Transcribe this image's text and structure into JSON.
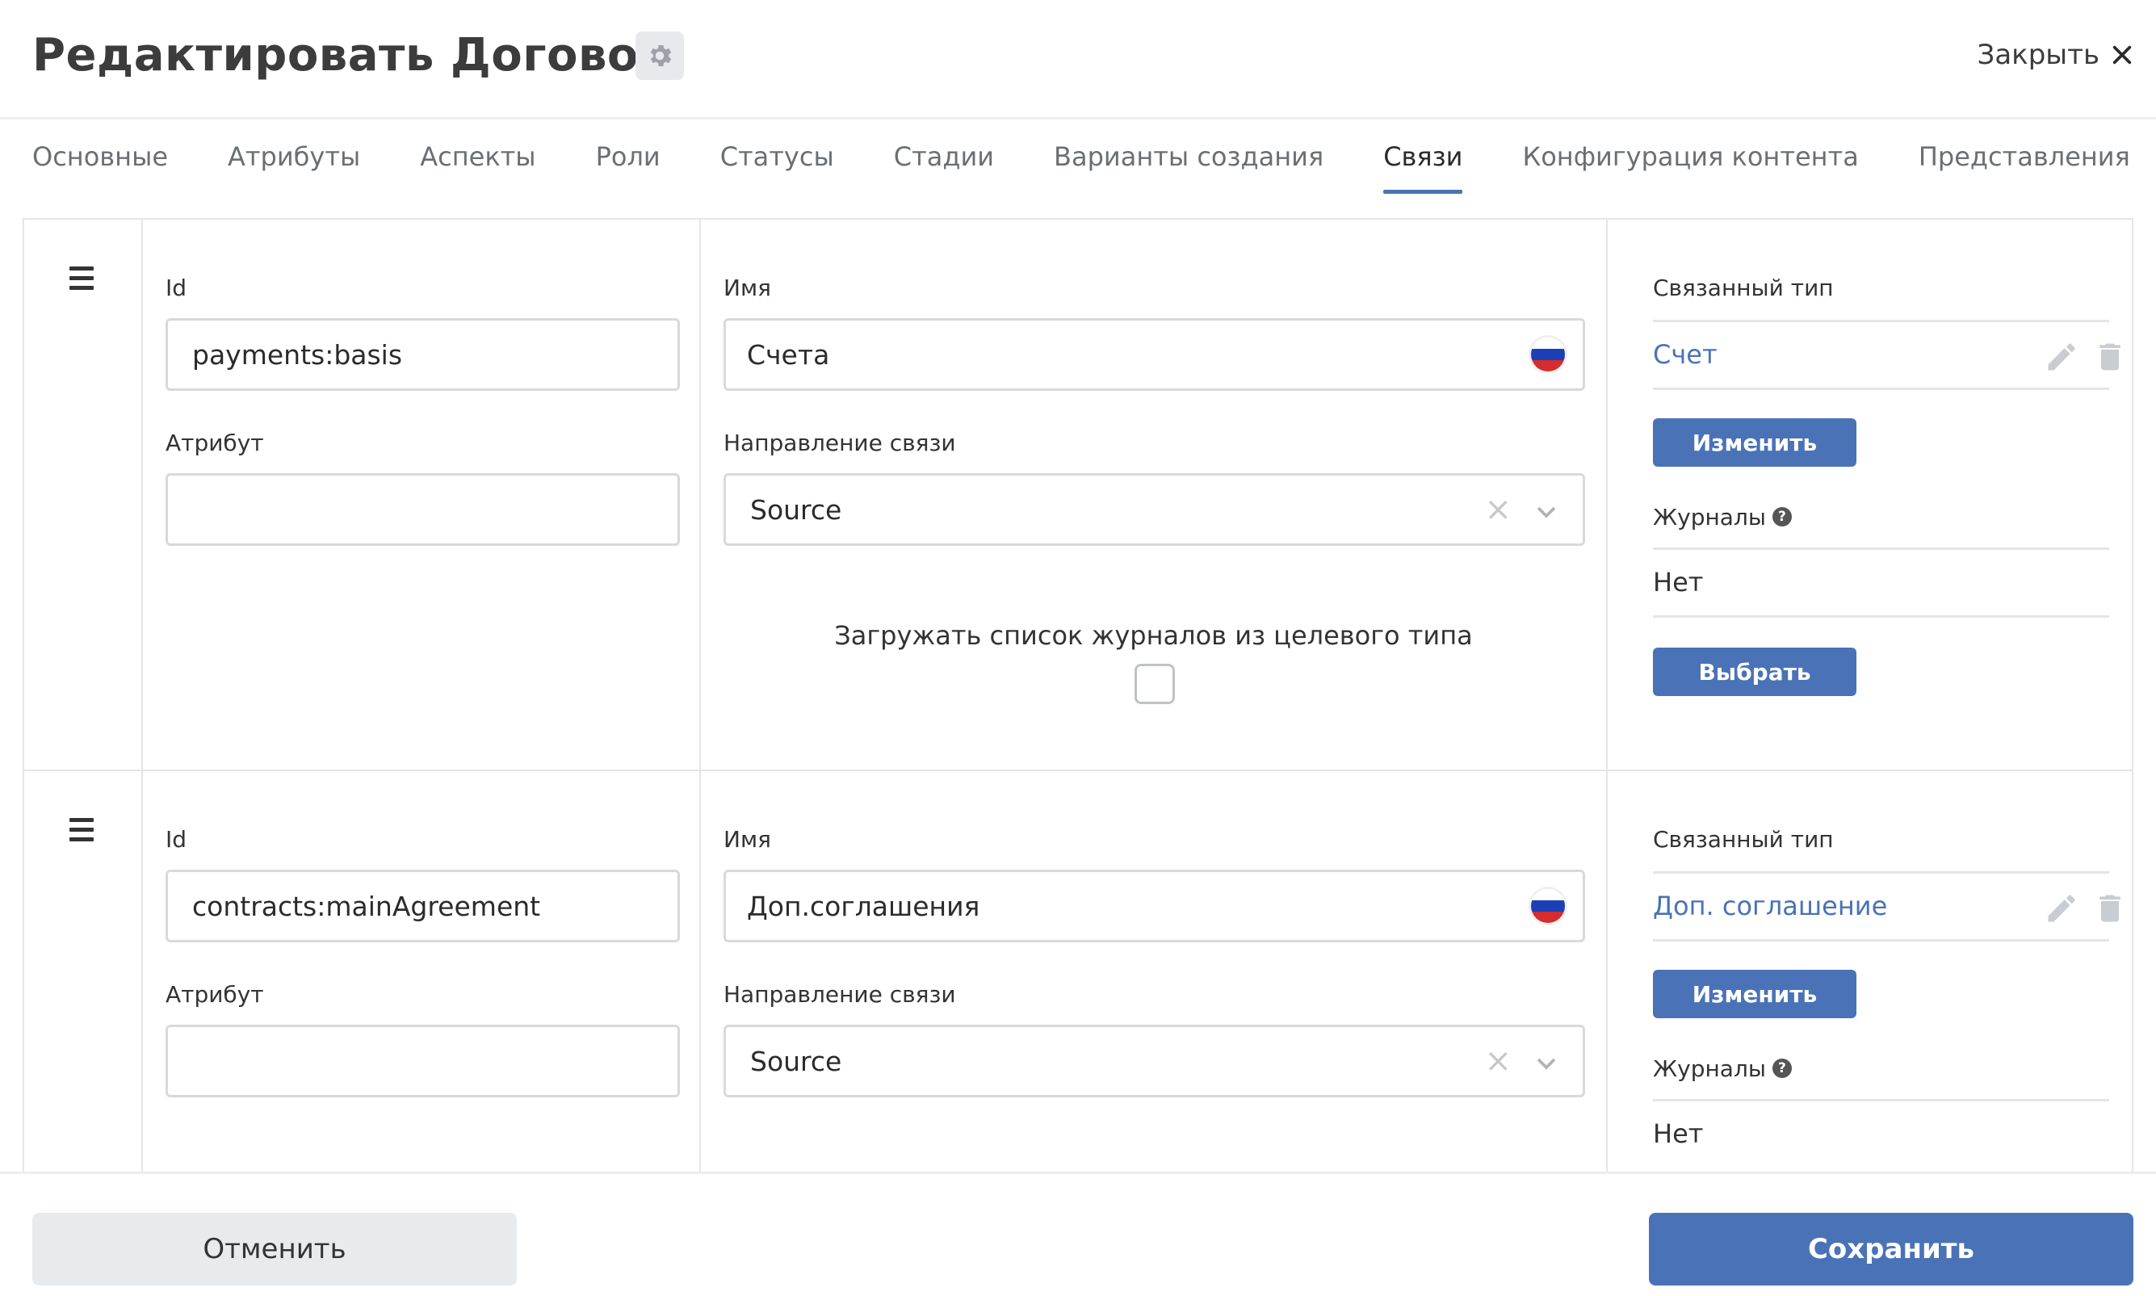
{
  "header": {
    "title": "Редактировать Договор",
    "close_label": "Закрыть"
  },
  "tabs": [
    {
      "label": "Основные"
    },
    {
      "label": "Атрибуты"
    },
    {
      "label": "Аспекты"
    },
    {
      "label": "Роли"
    },
    {
      "label": "Статусы"
    },
    {
      "label": "Стадии"
    },
    {
      "label": "Варианты создания"
    },
    {
      "label": "Связи",
      "active": true
    },
    {
      "label": "Конфигурация контента"
    },
    {
      "label": "Представления"
    }
  ],
  "rows": [
    {
      "id_label": "Id",
      "id_value": "payments:basis",
      "attribute_label": "Атрибут",
      "attribute_value": "",
      "name_label": "Имя",
      "name_value": "Счета",
      "direction_label": "Направление связи",
      "direction_value": "Source",
      "load_journals_label": "Загружать список журналов из целевого типа",
      "load_journals_checked": false,
      "linked_type_label": "Связанный тип",
      "linked_type_value": "Счет",
      "change_button": "Изменить",
      "journals_label": "Журналы",
      "journals_value": "Нет",
      "select_button": "Выбрать"
    },
    {
      "id_label": "Id",
      "id_value": "contracts:mainAgreement",
      "attribute_label": "Атрибут",
      "attribute_value": "",
      "name_label": "Имя",
      "name_value": "Доп.соглашения",
      "direction_label": "Направление связи",
      "direction_value": "Source",
      "linked_type_label": "Связанный тип",
      "linked_type_value": "Доп. соглашение",
      "change_button": "Изменить",
      "journals_label": "Журналы",
      "journals_value": "Нет"
    }
  ],
  "footer": {
    "cancel_label": "Отменить",
    "save_label": "Сохранить"
  },
  "colors": {
    "accent": "#4a72b7",
    "border": "#e3e5e8",
    "cancel_bg": "#e8ebee"
  },
  "icons": [
    "gear-icon",
    "close-icon",
    "drag-handle-icon",
    "russian-flag-icon",
    "clear-icon",
    "chevron-down-icon",
    "pencil-icon",
    "trash-icon",
    "help-icon"
  ]
}
